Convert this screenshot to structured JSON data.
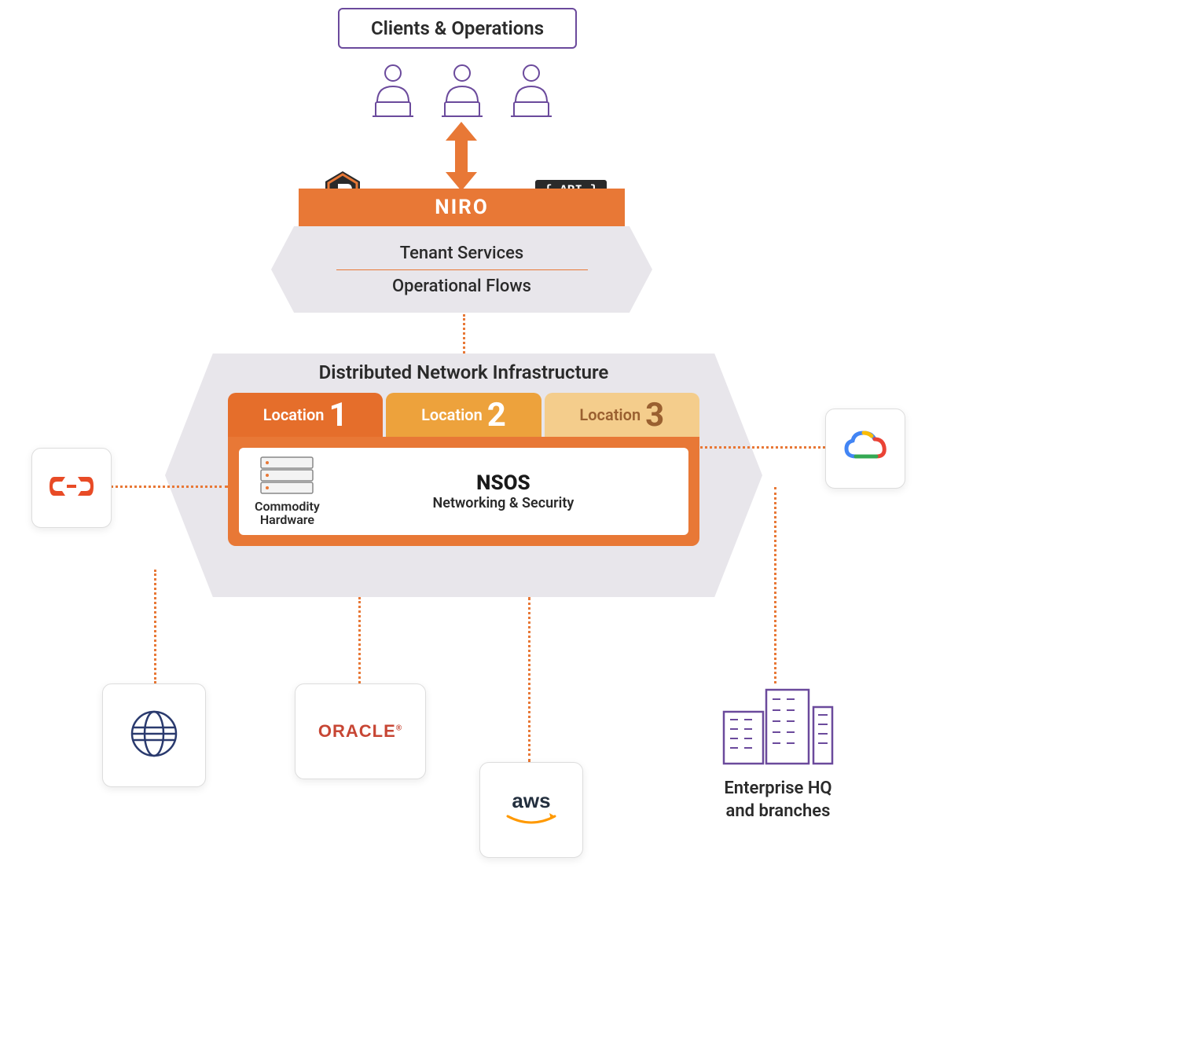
{
  "clients_label": "Clients & Operations",
  "niro_label": "NIRO",
  "api_label": "{ API }",
  "tenant_services": "Tenant Services",
  "operational_flows": "Operational Flows",
  "dni_title": "Distributed Network Infrastructure",
  "locations": [
    {
      "label": "Location",
      "num": "1"
    },
    {
      "label": "Location",
      "num": "2"
    },
    {
      "label": "Location",
      "num": "3"
    }
  ],
  "nsos": {
    "title": "NSOS",
    "subtitle": "Networking & Security"
  },
  "hardware": {
    "line1": "Commodity",
    "line2": "Hardware"
  },
  "endpoints": {
    "oracle": "ORACLE",
    "aws": "aws",
    "enterprise": {
      "line1": "Enterprise HQ",
      "line2": "and branches"
    }
  },
  "colors": {
    "orange": "#e87836",
    "purple": "#6b4a9c",
    "gray_bg": "#e8e6eb"
  }
}
